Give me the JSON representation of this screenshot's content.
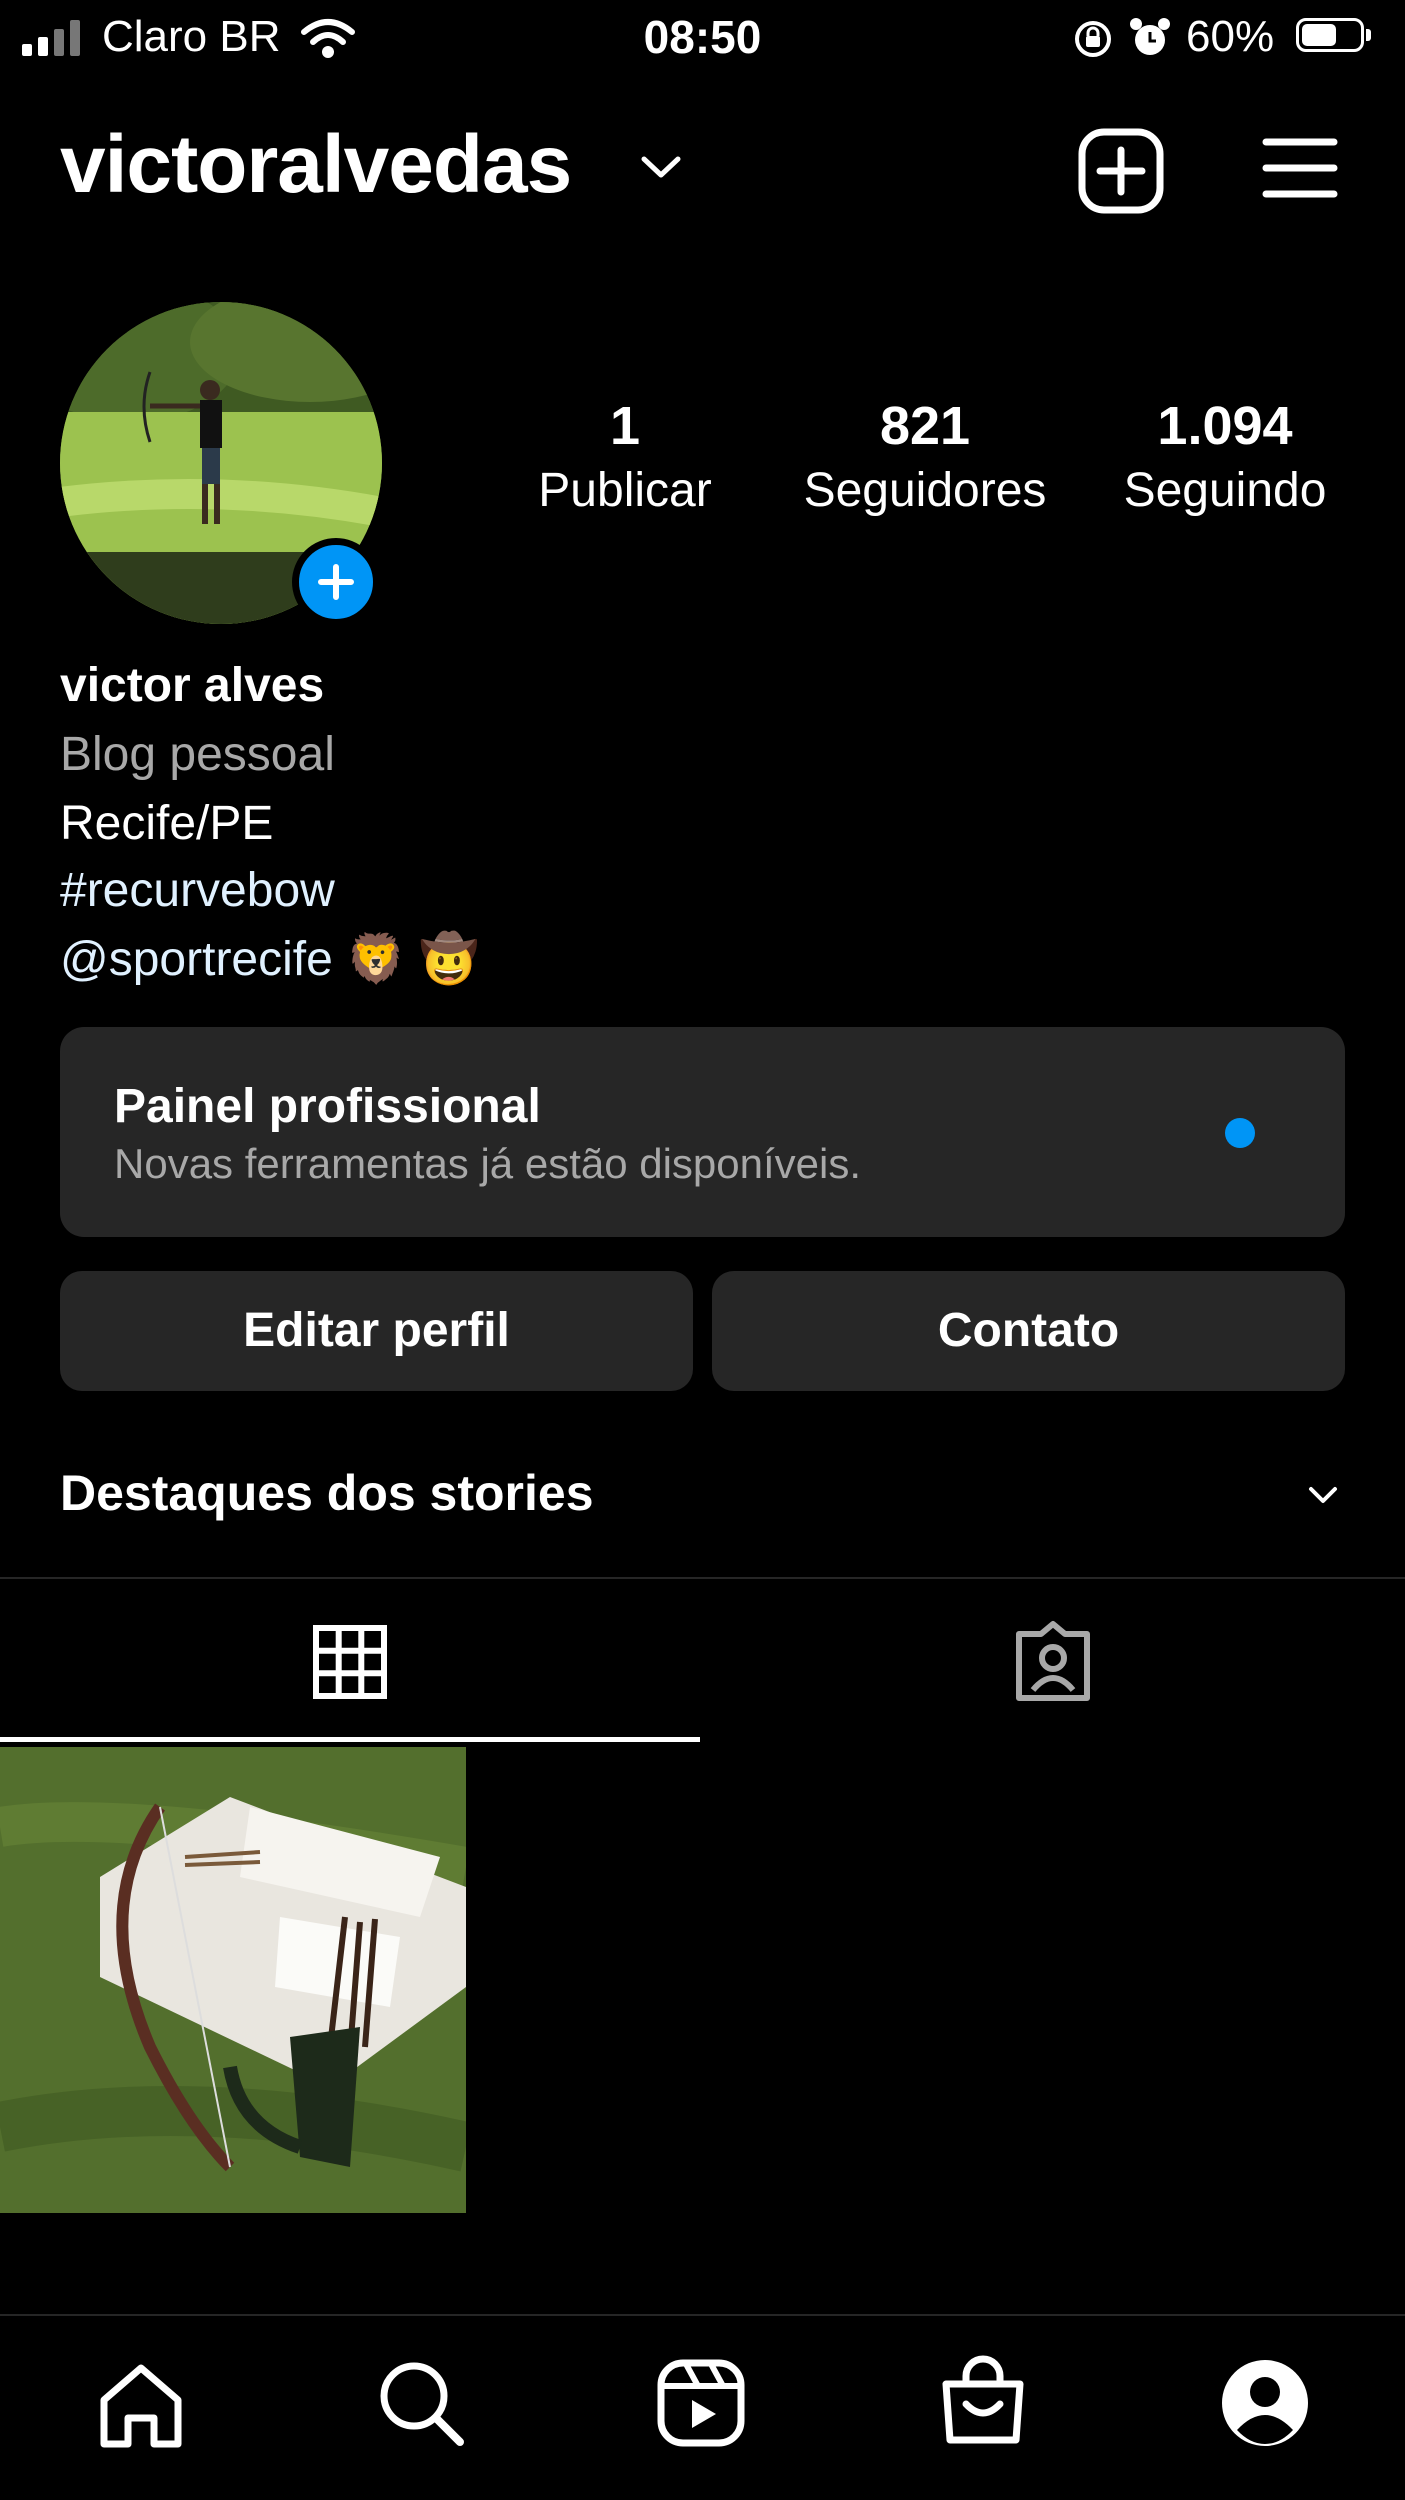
{
  "status_bar": {
    "carrier": "Claro BR",
    "time": "08:50",
    "battery_percent": "60%",
    "battery_level": 0.6
  },
  "header": {
    "username": "victoralvedas"
  },
  "profile": {
    "stats": [
      {
        "value": "1",
        "label": "Publicar"
      },
      {
        "value": "821",
        "label": "Seguidores"
      },
      {
        "value": "1.094",
        "label": "Seguindo"
      }
    ],
    "name": "victor alves",
    "category": "Blog pessoal",
    "location": "Recife/PE",
    "hashtag": "#recurvebow",
    "mention": "@sportrecife",
    "emoji_1": "🦁",
    "emoji_2": "🤠"
  },
  "dashboard": {
    "title": "Painel profissional",
    "subtitle": "Novas ferramentas já estão disponíveis."
  },
  "actions": {
    "edit_profile": "Editar perfil",
    "contact": "Contato"
  },
  "highlights": {
    "title": "Destaques dos stories"
  },
  "colors": {
    "background": "#000000",
    "card": "#262626",
    "accent_blue": "#0095f6",
    "secondary_text": "#a8a8a8"
  },
  "icons": {
    "status": [
      "signal-icon",
      "wifi-icon",
      "rotation-lock-icon",
      "alarm-icon",
      "battery-icon"
    ],
    "header": [
      "chevron-down-icon",
      "new-post-icon",
      "menu-icon"
    ],
    "tabs": [
      "grid-icon",
      "tagged-icon"
    ],
    "bottom_nav": [
      "home-icon",
      "search-icon",
      "reels-icon",
      "shop-icon",
      "profile-icon"
    ]
  }
}
